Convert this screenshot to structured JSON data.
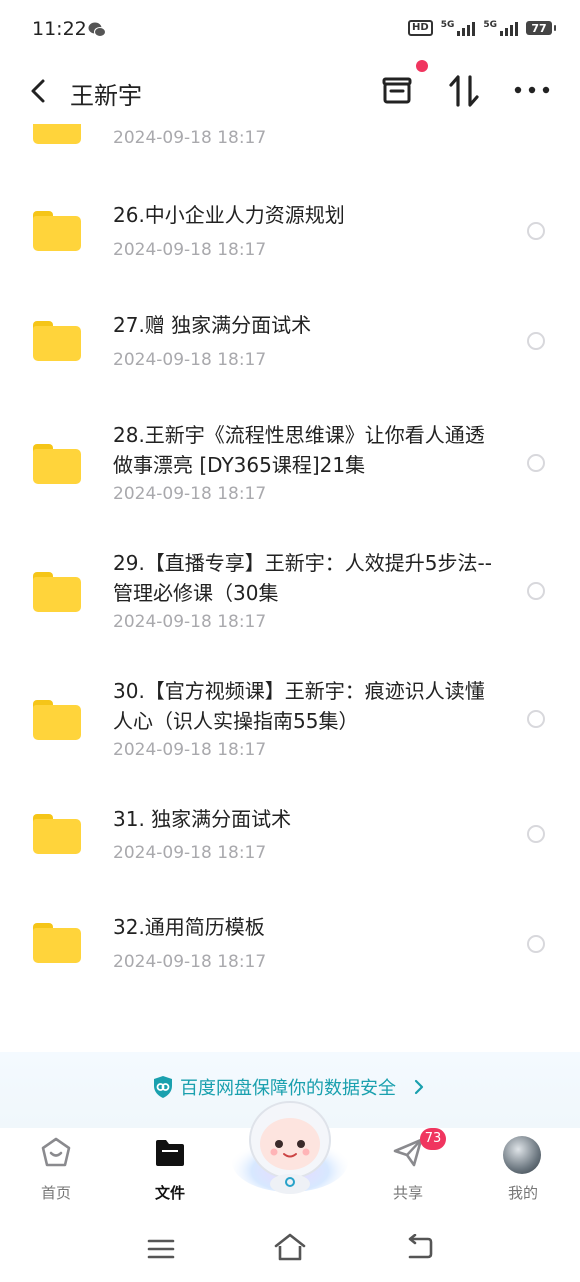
{
  "status_bar": {
    "time": "11:22",
    "network_labels": [
      "HD",
      "5G",
      "5G"
    ],
    "battery": "77"
  },
  "header": {
    "title": "王新宇"
  },
  "files": [
    {
      "name": "",
      "date": "2024-09-18  18:17"
    },
    {
      "name": "26.中小企业人力资源规划",
      "date": "2024-09-18  18:17"
    },
    {
      "name": "27.赠 独家满分面试术",
      "date": "2024-09-18  18:17"
    },
    {
      "name": "28.王新宇《流程性思维课》让你看人通透做事漂亮 [DY365课程]21集",
      "date": "2024-09-18  18:17"
    },
    {
      "name": "29.【直播专享】王新宇：人效提升5步法--管理必修课（30集",
      "date": "2024-09-18  18:17"
    },
    {
      "name": "30.【官方视频课】王新宇：痕迹识人读懂人心（识人实操指南55集）",
      "date": "2024-09-18  18:17"
    },
    {
      "name": "31. 独家满分面试术",
      "date": "2024-09-18  18:17"
    },
    {
      "name": "32.通用简历模板",
      "date": "2024-09-18  18:17"
    }
  ],
  "banner": {
    "text": "百度网盘保障你的数据安全"
  },
  "tabbar": {
    "home": "首页",
    "files": "文件",
    "share": "共享",
    "mine": "我的",
    "share_badge": "73"
  },
  "colors": {
    "accent": "#1aa0ae",
    "badge": "#f0355f",
    "folder": "#ffd43b",
    "date_text": "#a9a9ad"
  }
}
